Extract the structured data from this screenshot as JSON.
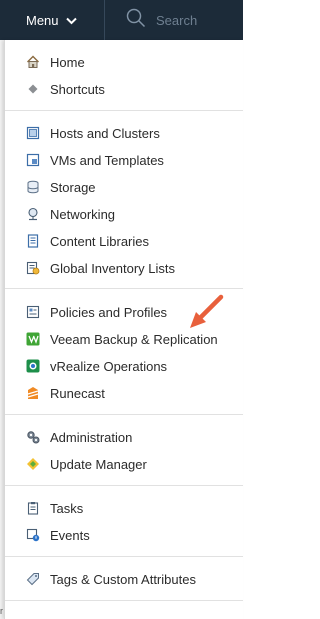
{
  "topbar": {
    "menu_label": "Menu",
    "search_placeholder": "Search"
  },
  "menu": {
    "home": "Home",
    "shortcuts": "Shortcuts",
    "hosts_and_clusters": "Hosts and Clusters",
    "vms_and_templates": "VMs and Templates",
    "storage": "Storage",
    "networking": "Networking",
    "content_libraries": "Content Libraries",
    "global_inventory_lists": "Global Inventory Lists",
    "policies_and_profiles": "Policies and Profiles",
    "veeam": "Veeam Backup & Replication",
    "vrealize": "vRealize Operations",
    "runecast": "Runecast",
    "administration": "Administration",
    "update_manager": "Update Manager",
    "tasks": "Tasks",
    "events": "Events",
    "tags": "Tags & Custom Attributes"
  },
  "edge_glyph": "r",
  "colors": {
    "topbar_bg": "#1c2b39",
    "annotation_arrow": "#e8603c",
    "veeam_green": "#3fa535"
  }
}
